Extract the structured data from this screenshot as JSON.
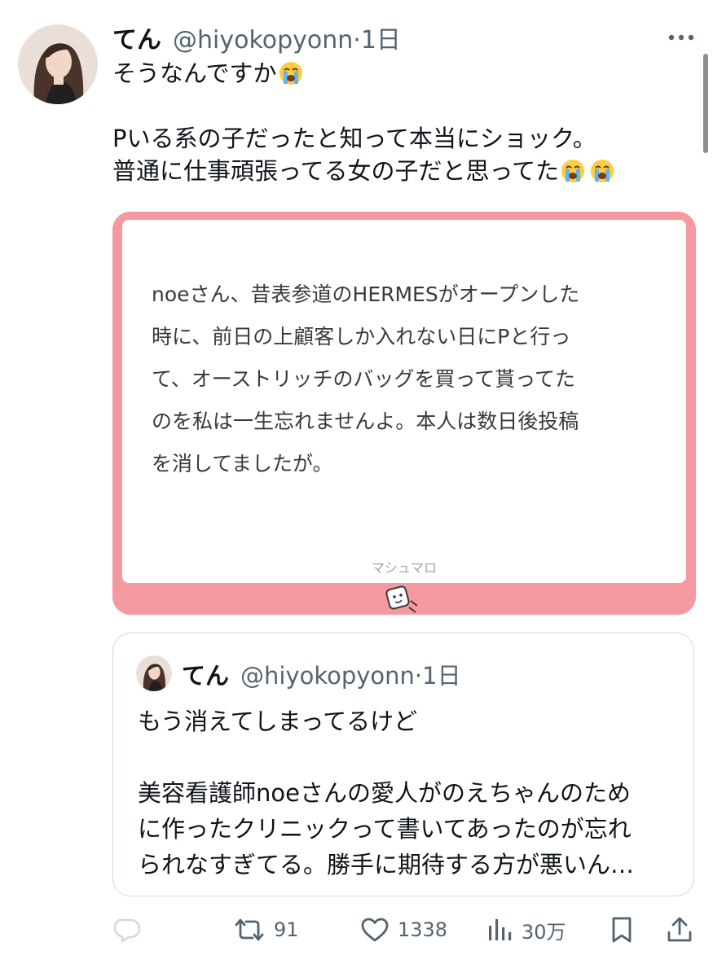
{
  "tweet": {
    "author": {
      "display_name": "てん",
      "handle": "@hiyokopyonn",
      "time": "1日",
      "handle_line": "@hiyokopyonn·1日"
    },
    "lines": [
      "そうなんですか",
      "",
      "Pいる系の子だったと知って本当にショック。",
      "普通に仕事頑張ってる女の子だと思ってた"
    ]
  },
  "marshmallow": {
    "lines": [
      "noeさん、昔表参道のHERMESがオープンした",
      "時に、前日の上顧客しか入れない日にPと行っ",
      "て、オーストリッチのバッグを買って貰ってた",
      "のを私は一生忘れませんよ。本人は数日後投稿",
      "を消してましたが。"
    ],
    "brand": "マシュマロ",
    "color": "#f4999f"
  },
  "quote": {
    "author": {
      "display_name": "てん",
      "handle_line": "@hiyokopyonn·1日"
    },
    "lines": [
      "もう消えてしまってるけど",
      "",
      "美容看護師noeさんの愛人がのえちゃんのため",
      "に作ったクリニックって書いてあったのが忘れ",
      "られなすぎてる。勝手に期待する方が悪いん…"
    ]
  },
  "actions": {
    "reply": {
      "icon": "reply-icon",
      "count": ""
    },
    "retweet": {
      "icon": "retweet-icon",
      "count": "91"
    },
    "like": {
      "icon": "heart-icon",
      "count": "1338"
    },
    "views": {
      "icon": "views-icon",
      "count": "30万"
    },
    "bookmark": {
      "icon": "bookmark-icon"
    },
    "share": {
      "icon": "share-icon"
    }
  },
  "colors": {
    "text": "#0f1419",
    "secondary": "#536471",
    "border": "#cfd9de",
    "marshmallow_pink": "#f4999f"
  }
}
